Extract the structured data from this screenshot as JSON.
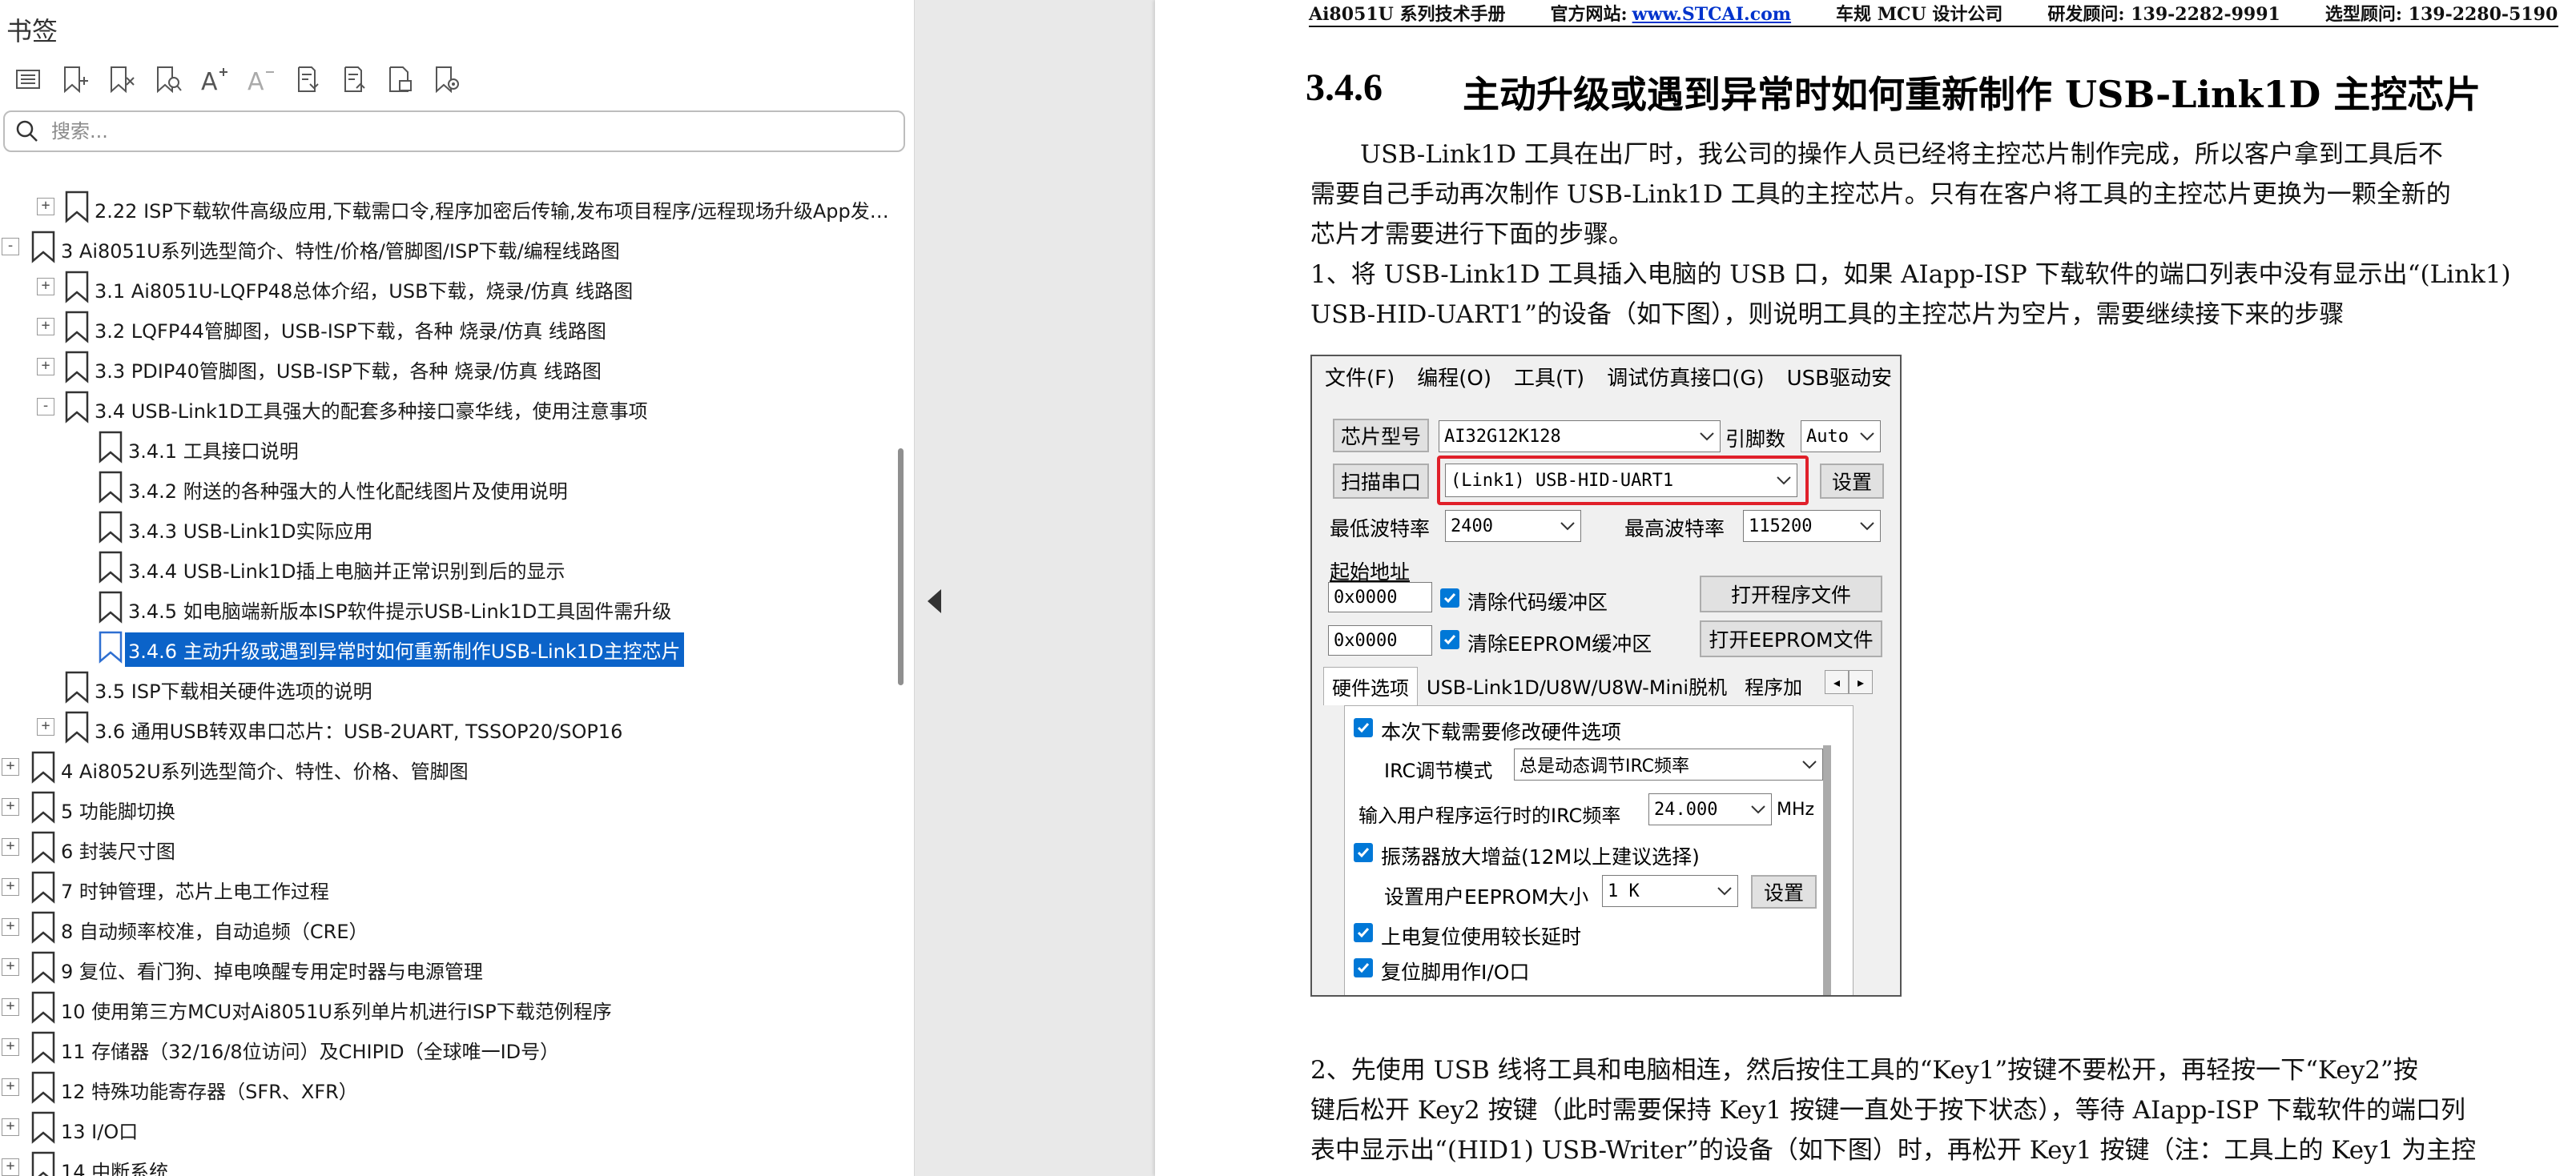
{
  "sidebar": {
    "title": "书签",
    "search_placeholder": "搜索...",
    "toolbar_icons": [
      "bookmark-list-icon",
      "add-bookmark-icon",
      "delete-bookmark-icon",
      "find-bookmark-icon",
      "font-larger-icon",
      "font-smaller-icon",
      "expand-all-icon",
      "collapse-all-icon",
      "bookmark-page-icon",
      "bookmark-settings-icon"
    ],
    "tree": [
      {
        "label": "2.22  ISP下载软件高级应用,下载需口令,程序加密后传输,发布项目程序/远程现场升级App发…",
        "level": 1,
        "expander": "+"
      },
      {
        "label": "3  Ai8051U系列选型简介、特性/价格/管脚图/ISP下载/编程线路图",
        "level": 0,
        "expander": "-"
      },
      {
        "label": "3.1  Ai8051U-LQFP48总体介绍，USB下载，烧录/仿真 线路图",
        "level": 1,
        "expander": "+"
      },
      {
        "label": "3.2  LQFP44管脚图，USB-ISP下载，各种 烧录/仿真 线路图",
        "level": 1,
        "expander": "+"
      },
      {
        "label": "3.3  PDIP40管脚图，USB-ISP下载，各种 烧录/仿真 线路图",
        "level": 1,
        "expander": "+"
      },
      {
        "label": "3.4  USB-Link1D工具强大的配套多种接口豪华线，使用注意事项",
        "level": 1,
        "expander": "-"
      },
      {
        "label": "3.4.1  工具接口说明",
        "level": 2,
        "expander": ""
      },
      {
        "label": "3.4.2  附送的各种强大的人性化配线图片及使用说明",
        "level": 2,
        "expander": ""
      },
      {
        "label": "3.4.3  USB-Link1D实际应用",
        "level": 2,
        "expander": ""
      },
      {
        "label": "3.4.4  USB-Link1D插上电脑并正常识别到后的显示",
        "level": 2,
        "expander": ""
      },
      {
        "label": "3.4.5  如电脑端新版本ISP软件提示USB-Link1D工具固件需升级",
        "level": 2,
        "expander": ""
      },
      {
        "label": "3.4.6  主动升级或遇到异常时如何重新制作USB-Link1D主控芯片",
        "level": 2,
        "expander": "",
        "selected": true
      },
      {
        "label": "3.5  ISP下载相关硬件选项的说明",
        "level": 1,
        "expander": ""
      },
      {
        "label": "3.6  通用USB转双串口芯片：USB-2UART, TSSOP20/SOP16",
        "level": 1,
        "expander": "+"
      },
      {
        "label": "4  Ai8052U系列选型简介、特性、价格、管脚图",
        "level": 0,
        "expander": "+"
      },
      {
        "label": "5  功能脚切换",
        "level": 0,
        "expander": "+"
      },
      {
        "label": "6  封装尺寸图",
        "level": 0,
        "expander": "+"
      },
      {
        "label": "7  时钟管理，芯片上电工作过程",
        "level": 0,
        "expander": "+"
      },
      {
        "label": "8  自动频率校准，自动追频（CRE）",
        "level": 0,
        "expander": "+"
      },
      {
        "label": "9  复位、看门狗、掉电唤醒专用定时器与电源管理",
        "level": 0,
        "expander": "+"
      },
      {
        "label": "10  使用第三方MCU对Ai8051U系列单片机进行ISP下载范例程序",
        "level": 0,
        "expander": "+"
      },
      {
        "label": "11  存储器（32/16/8位访问）及CHIPID（全球唯一ID号）",
        "level": 0,
        "expander": "+"
      },
      {
        "label": "12  特殊功能寄存器（SFR、XFR）",
        "level": 0,
        "expander": "+"
      },
      {
        "label": "13  I/O口",
        "level": 0,
        "expander": "+"
      },
      {
        "label": "14  中断系统",
        "level": 0,
        "expander": "+"
      }
    ]
  },
  "page": {
    "header": {
      "manual": "Ai8051U 系列技术手册",
      "website_label": "官方网站:",
      "website": "www.STCAI.com",
      "design_center": "车规 MCU 设计公司",
      "dev_consult": "研发顾问: 139-2282-9991",
      "sel_consult": "选型顾问: 139-2280-5190"
    },
    "section_number": "3.4.6",
    "section_title": "主动升级或遇到异常时如何重新制作 USB-Link1D 主控芯片",
    "para1": [
      "　　USB-Link1D 工具在出厂时，我公司的操作人员已经将主控芯片制作完成，所以客户拿到工具后不",
      "需要自己手动再次制作 USB-Link1D 工具的主控芯片。只有在客户将工具的主控芯片更换为一颗全新的",
      "芯片才需要进行下面的步骤。"
    ],
    "para2": [
      "1、将 USB-Link1D 工具插入电脑的 USB 口，如果 AIapp-ISP 下载软件的端口列表中没有显示出“(Link1)",
      "USB-HID-UART1”的设备（如下图），则说明工具的主控芯片为空片，需要继续接下来的步骤"
    ],
    "para3": [
      "2、先使用 USB 线将工具和电脑相连，然后按住工具的“Key1”按键不要松开，再轻按一下“Key2”按",
      "键后松开 Key2 按键（此时需要保持 Key1 按键一直处于按下状态），等待 AIapp-ISP 下载软件的端口列",
      "表中显示出“(HID1) USB-Writer”的设备（如下图）时，再松开 Key1 按键（注：工具上的 Key1 为主控"
    ],
    "screenshot": {
      "menu": [
        "文件(F)",
        "编程(O)",
        "工具(T)",
        "调试仿真接口(G)",
        "USB驱动安"
      ],
      "chip_model_label": "芯片型号",
      "chip_model_value": "AI32G12K128",
      "pin_count_label": "引脚数",
      "pin_count_value": "Auto",
      "scan_port_button": "扫描串口",
      "port_value": "(Link1) USB-HID-UART1",
      "settings_button": "设置",
      "min_baud_label": "最低波特率",
      "min_baud_value": "2400",
      "max_baud_label": "最高波特率",
      "max_baud_value": "115200",
      "start_addr_label": "起始地址",
      "code_addr_value": "0x0000",
      "clear_code_label": "清除代码缓冲区",
      "open_program_button": "打开程序文件",
      "eeprom_addr_value": "0x0000",
      "clear_eeprom_label": "清除EEPROM缓冲区",
      "open_eeprom_button": "打开EEPROM文件",
      "tabs": [
        "硬件选项",
        "USB-Link1D/U8W/U8W-Mini脱机",
        "程序加"
      ],
      "tab_arrow_left": "◂",
      "tab_arrow_right": "▸",
      "opt_modify_hw": "本次下载需要修改硬件选项",
      "irc_mode_label": "IRC调节模式",
      "irc_mode_value": "总是动态调节IRC频率",
      "irc_freq_label": "输入用户程序运行时的IRC频率",
      "irc_freq_value": "24.000",
      "irc_freq_unit": "MHz",
      "opt_osc_gain": "振荡器放大增益(12M以上建议选择)",
      "eeprom_size_label": "设置用户EEPROM大小",
      "eeprom_size_value": "1  K",
      "eeprom_settings_button": "设置",
      "opt_long_reset": "上电复位使用较长延时",
      "opt_reset_io": "复位脚用作I/O口"
    }
  }
}
